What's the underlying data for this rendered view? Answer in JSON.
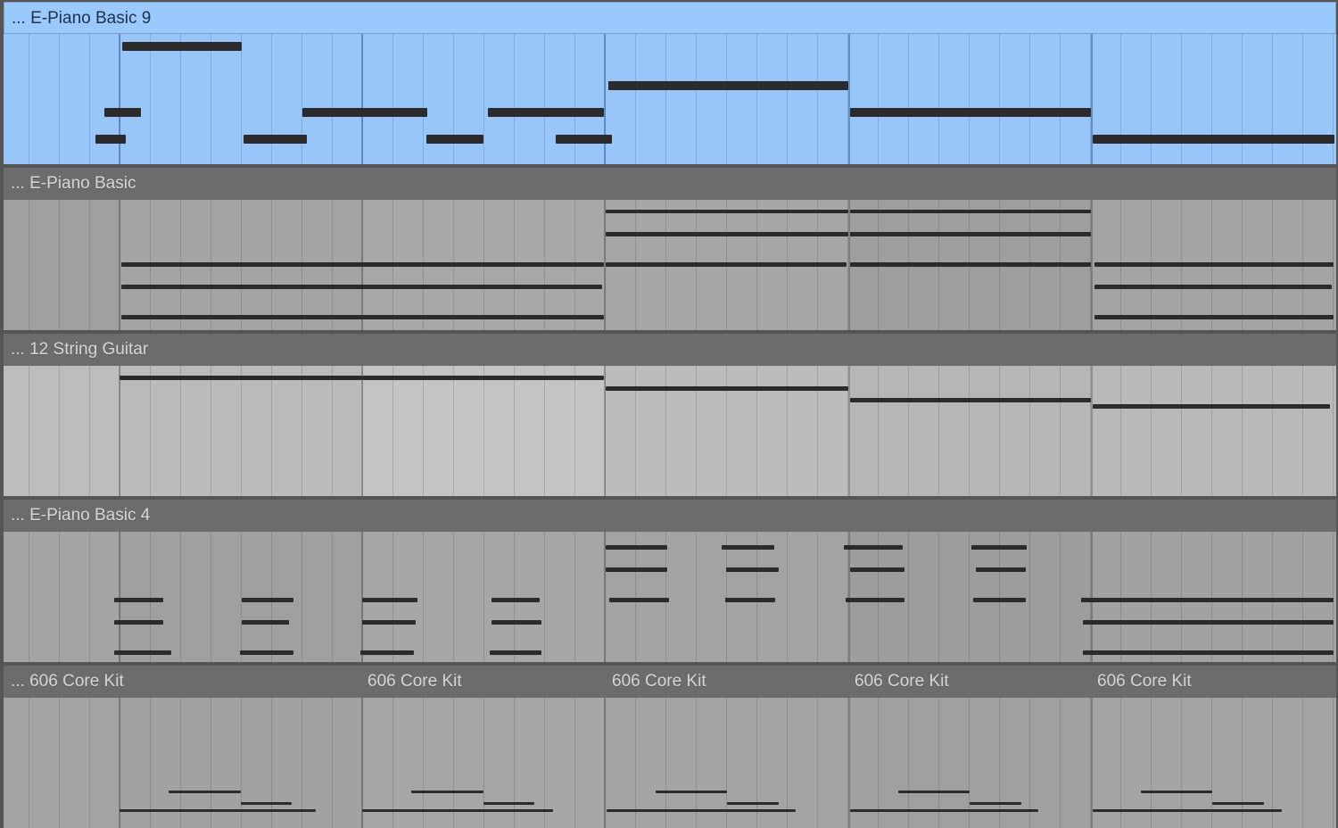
{
  "colors": {
    "selected_header": "#9ac9fd",
    "selected_body": "#99c6f9",
    "header": "#6c6c6c",
    "note": "#2b2b2b"
  },
  "tracks": [
    {
      "id": "track-1",
      "selected": true,
      "clips": [
        {
          "name": "... E-Piano Basic 9"
        }
      ]
    },
    {
      "id": "track-2",
      "selected": false,
      "clips": [
        {
          "name": "... E-Piano Basic"
        }
      ]
    },
    {
      "id": "track-3",
      "selected": false,
      "clips": [
        {
          "name": "... 12 String Guitar"
        }
      ]
    },
    {
      "id": "track-4",
      "selected": false,
      "clips": [
        {
          "name": "... E-Piano Basic 4"
        }
      ]
    },
    {
      "id": "track-5",
      "selected": false,
      "clips": [
        {
          "name": "... 606 Core Kit"
        },
        {
          "name": "606 Core Kit"
        },
        {
          "name": "606 Core Kit"
        },
        {
          "name": "606 Core Kit"
        },
        {
          "name": "606 Core Kit"
        }
      ]
    }
  ]
}
